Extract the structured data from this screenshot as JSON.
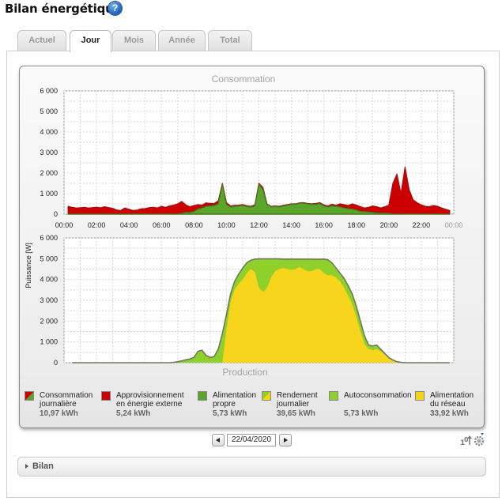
{
  "page": {
    "title": "Bilan énergétique",
    "help_glyph": "?"
  },
  "tabs": [
    {
      "label": "Actuel",
      "active": false
    },
    {
      "label": "Jour",
      "active": true
    },
    {
      "label": "Mois",
      "active": false
    },
    {
      "label": "Année",
      "active": false
    },
    {
      "label": "Total",
      "active": false
    }
  ],
  "chart_data": [
    {
      "type": "area",
      "title": "Consommation",
      "ylabel": "Puissance [W]",
      "ylim": [
        0,
        6000
      ],
      "yticks": [
        "0",
        "1 000",
        "2 000",
        "3 000",
        "4 000",
        "5 000",
        "6 000"
      ],
      "xticks": [
        "00:00",
        "02:00",
        "04:00",
        "06:00",
        "08:00",
        "10:00",
        "12:00",
        "14:00",
        "16:00",
        "18:00",
        "20:00",
        "22:00",
        "00:00"
      ],
      "grid": true,
      "x_hours": [
        0.25,
        0.5,
        0.75,
        1,
        1.25,
        1.5,
        1.75,
        2,
        2.25,
        2.5,
        2.75,
        3,
        3.25,
        3.5,
        3.75,
        4,
        4.25,
        4.5,
        4.75,
        5,
        5.25,
        5.5,
        5.75,
        6,
        6.25,
        6.5,
        6.75,
        7,
        7.25,
        7.5,
        7.75,
        8,
        8.25,
        8.5,
        8.75,
        9,
        9.25,
        9.5,
        9.75,
        10,
        10.25,
        10.5,
        10.75,
        11,
        11.25,
        11.5,
        11.75,
        12,
        12.25,
        12.5,
        12.75,
        13,
        13.25,
        13.5,
        13.75,
        14,
        14.25,
        14.5,
        14.75,
        15,
        15.25,
        15.5,
        15.75,
        16,
        16.25,
        16.5,
        16.75,
        17,
        17.25,
        17.5,
        17.75,
        18,
        18.25,
        18.5,
        18.75,
        19,
        19.25,
        19.5,
        19.75,
        20,
        20.25,
        20.5,
        20.75,
        21,
        21.25,
        21.5,
        21.75,
        22,
        22.25,
        22.5,
        22.75,
        23,
        23.25,
        23.5,
        23.75
      ],
      "series": [
        {
          "name": "Consommation journalière",
          "color": "#5a9a2a",
          "values": [
            380,
            330,
            300,
            310,
            330,
            300,
            320,
            340,
            310,
            360,
            320,
            280,
            200,
            180,
            300,
            240,
            180,
            200,
            260,
            270,
            320,
            340,
            300,
            380,
            330,
            400,
            440,
            500,
            620,
            450,
            360,
            420,
            460,
            440,
            550,
            520,
            520,
            650,
            1500,
            560,
            400,
            430,
            440,
            470,
            410,
            380,
            450,
            1500,
            1300,
            500,
            380,
            400,
            380,
            430,
            460,
            500,
            500,
            550,
            560,
            520,
            500,
            520,
            560,
            450,
            400,
            480,
            430,
            500,
            460,
            420,
            500,
            440,
            360,
            300,
            330,
            400,
            360,
            300,
            360,
            430,
            1500,
            1950,
            1000,
            2300,
            1200,
            700,
            550,
            450,
            380,
            370,
            420,
            380,
            300,
            240,
            180
          ]
        },
        {
          "name": "Alimentation propre",
          "color": "#5aa52a",
          "values": [
            0,
            0,
            0,
            0,
            0,
            0,
            0,
            0,
            0,
            0,
            0,
            0,
            0,
            0,
            0,
            0,
            0,
            0,
            0,
            0,
            0,
            0,
            0,
            0,
            0,
            0,
            0,
            0,
            40,
            90,
            80,
            130,
            250,
            300,
            380,
            400,
            420,
            500,
            1450,
            480,
            350,
            380,
            400,
            430,
            370,
            350,
            400,
            1450,
            1200,
            480,
            360,
            380,
            350,
            400,
            430,
            480,
            480,
            530,
            530,
            500,
            470,
            480,
            520,
            400,
            350,
            400,
            380,
            350,
            300,
            270,
            250,
            200,
            130,
            120,
            100,
            80,
            60,
            50,
            50,
            40,
            0,
            0,
            0,
            0,
            0,
            0,
            0,
            0,
            0,
            0,
            0,
            0,
            0,
            0,
            0
          ]
        }
      ],
      "colors": {
        "red": "#cc0000",
        "green": "#5aa52a"
      }
    },
    {
      "type": "area",
      "title": "Production",
      "ylabel": "Puissance [W]",
      "ylim": [
        0,
        6000
      ],
      "yticks": [
        "0",
        "1 000",
        "2 000",
        "3 000",
        "4 000",
        "5 000",
        "6 000"
      ],
      "grid": true,
      "x_hours": [
        0.5,
        6.5,
        6.75,
        7,
        7.25,
        7.5,
        7.75,
        8,
        8.25,
        8.5,
        8.75,
        9,
        9.25,
        9.5,
        9.75,
        10,
        10.25,
        10.5,
        10.75,
        11,
        11.25,
        11.5,
        11.75,
        12,
        12.25,
        12.5,
        12.75,
        13,
        13.25,
        13.5,
        13.75,
        14,
        14.25,
        14.5,
        14.75,
        15,
        15.25,
        15.5,
        15.75,
        16,
        16.25,
        16.5,
        16.75,
        17,
        17.25,
        17.5,
        17.75,
        18,
        18.25,
        18.5,
        18.75,
        19,
        19.25,
        19.5,
        19.75,
        20,
        20.25,
        20.5,
        20.75,
        21,
        21.25,
        23.75
      ],
      "series": [
        {
          "name": "Rendement journalier",
          "color": "#f5d316",
          "values": [
            0,
            0,
            20,
            50,
            90,
            140,
            180,
            250,
            550,
            600,
            350,
            250,
            300,
            650,
            1400,
            2300,
            3300,
            3900,
            4250,
            4550,
            4800,
            4920,
            4980,
            4990,
            4990,
            4990,
            4990,
            4990,
            4990,
            4980,
            4980,
            4980,
            4980,
            4980,
            4980,
            4980,
            4980,
            4970,
            4970,
            4980,
            4950,
            4800,
            4550,
            4300,
            4050,
            3700,
            3300,
            2700,
            2000,
            1300,
            850,
            800,
            850,
            650,
            450,
            250,
            130,
            50,
            20,
            0,
            0,
            0
          ]
        },
        {
          "name": "Alimentation du réseau",
          "color": "#f5d316",
          "values": [
            0,
            0,
            0,
            0,
            0,
            0,
            0,
            0,
            0,
            0,
            0,
            0,
            0,
            0,
            0,
            1600,
            2900,
            3500,
            3800,
            4000,
            4300,
            4500,
            4350,
            3600,
            3400,
            3600,
            4100,
            4400,
            4500,
            4550,
            4500,
            4450,
            4500,
            4600,
            4500,
            4400,
            4400,
            4500,
            4500,
            4300,
            4200,
            4200,
            4100,
            3900,
            3600,
            3200,
            2800,
            2200,
            1500,
            900,
            650,
            600,
            650,
            550,
            400,
            200,
            100,
            40,
            10,
            0,
            0,
            0
          ]
        }
      ]
    }
  ],
  "legend": [
    {
      "label_line1": "Consommation",
      "label_line2": "journalière",
      "value": "10,97 kWh",
      "swatch": "split-red-green"
    },
    {
      "label_line1": "Approvisionnement",
      "label_line2": "en énergie externe",
      "value": "5,24 kWh",
      "swatch": "#cc0000"
    },
    {
      "label_line1": "Alimentation",
      "label_line2": "propre",
      "value": "5,73 kWh",
      "swatch": "#5aa52a"
    },
    {
      "label_line1": "Rendement",
      "label_line2": "journalier",
      "value": "39,65 kWh",
      "swatch": "split-green-yellow"
    },
    {
      "label_line1": "Autoconsommation",
      "label_line2": "",
      "value": "5,73 kWh",
      "swatch": "#8fd12a"
    },
    {
      "label_line1": "Alimentation",
      "label_line2": "du réseau",
      "value": "33,92 kWh",
      "swatch": "#f5d316"
    }
  ],
  "date_nav": {
    "date": "22/04/2020"
  },
  "bilan": {
    "label": "Bilan"
  }
}
